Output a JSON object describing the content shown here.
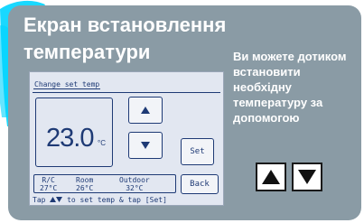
{
  "title": "Екран встановлення температури",
  "description": "Ви можете дотиком встановити необхідну температуру за допомогою",
  "hint_icons": [
    "up-arrow-icon",
    "down-arrow-icon"
  ],
  "colors": {
    "card_bg": "#8a9ba5",
    "lcd_bg": "#e2e7f1",
    "lcd_text": "#1e3a75",
    "brush": "#00d4ff"
  },
  "lcd": {
    "header": "Change set temp",
    "temperature": "23.0",
    "unit": "°C",
    "up_icon": "up-arrow-icon",
    "down_icon": "down-arrow-icon",
    "set_label": "Set",
    "back_label": "Back",
    "info": {
      "rc_label": "R/C",
      "rc_value": "27°C",
      "room_label": "Room",
      "room_value": "26°C",
      "outdoor_label": "Outdoor",
      "outdoor_value": "32°C"
    },
    "footer_pre": "Tap",
    "footer_post": "to set temp & tap [Set]"
  }
}
